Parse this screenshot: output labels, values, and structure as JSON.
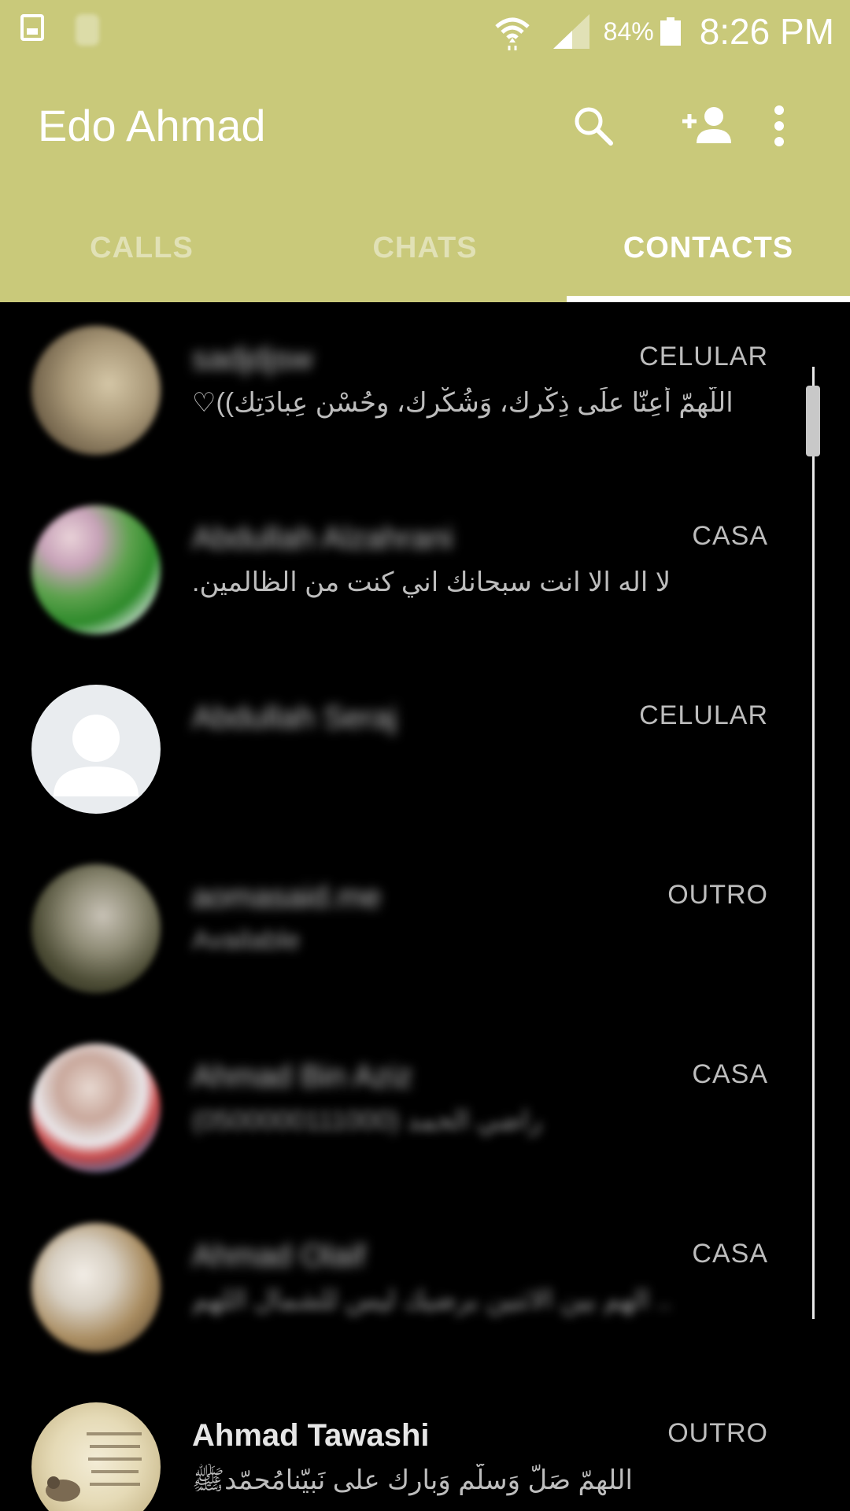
{
  "status_bar": {
    "battery": "84%",
    "time": "8:26 PM"
  },
  "header": {
    "title": "Edo Ahmad",
    "search_icon": "search-icon",
    "add_contact_icon": "add-person-icon",
    "menu_icon": "more-vertical-icon",
    "color": "#c9c97a"
  },
  "tabs": [
    {
      "label": "CALLS",
      "active": false
    },
    {
      "label": "CHATS",
      "active": false
    },
    {
      "label": "CONTACTS",
      "active": true
    }
  ],
  "contacts": [
    {
      "name": "sadjdjsw",
      "status": "اللّهمّ أعِنّا علَى ذِكْرِك، وَشُكْرِك، وحُسْنِ عِبادَتِك))♡",
      "type": "CELULAR",
      "name_blurred": true,
      "status_blurred": false
    },
    {
      "name": "Abdullah Alzahrani",
      "status": "لا اله الا انت سبحانك اني كنت من الظالمين.",
      "type": "CASA",
      "name_blurred": true,
      "status_blurred": false
    },
    {
      "name": "Abdullah Seraj",
      "status": "",
      "type": "CELULAR",
      "name_blurred": true,
      "status_blurred": false
    },
    {
      "name": "aomasaid.me",
      "status": "Available",
      "type": "OUTRO",
      "name_blurred": true,
      "status_blurred": true
    },
    {
      "name": "Ahmad Bin Aziz",
      "status": "راضي الحمد (0500000111000)",
      "type": "CASA",
      "name_blurred": true,
      "status_blurred": true
    },
    {
      "name": "Ahmad Olaif",
      "status": ".. الهم بين الاثنين برضيك ليس للشمال اللهم",
      "type": "CASA",
      "name_blurred": true,
      "status_blurred": true
    },
    {
      "name": "Ahmad Tawashi",
      "status": "اللهمّ صَلّ وَسلّم وَبارك على نَبيّنامُحمّدﷺ",
      "type": "OUTRO",
      "name_blurred": false,
      "status_blurred": false
    }
  ]
}
